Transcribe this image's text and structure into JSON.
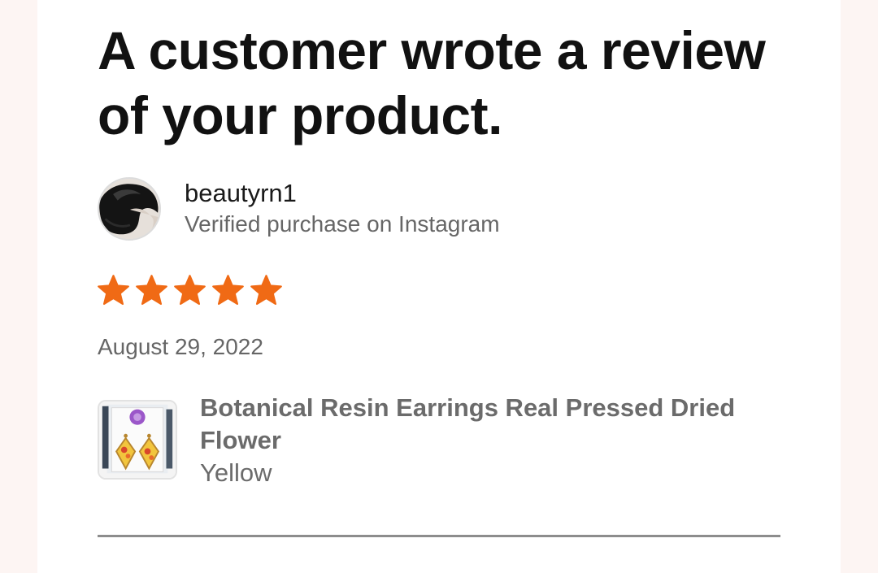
{
  "email": {
    "headline": "A customer wrote a review of your product."
  },
  "reviewer": {
    "name": "beautyrn1",
    "source": "Verified purchase on Instagram",
    "avatar_icon": "profile-photo-dark-hair"
  },
  "review": {
    "rating": 5,
    "rating_max": 5,
    "star_color": "#f06a15",
    "date": "August 29, 2022"
  },
  "product": {
    "title": "Botanical Resin Earrings Real Pressed Dried Flower",
    "variant": "Yellow",
    "thumbnail_icon": "earrings-product-photo"
  }
}
